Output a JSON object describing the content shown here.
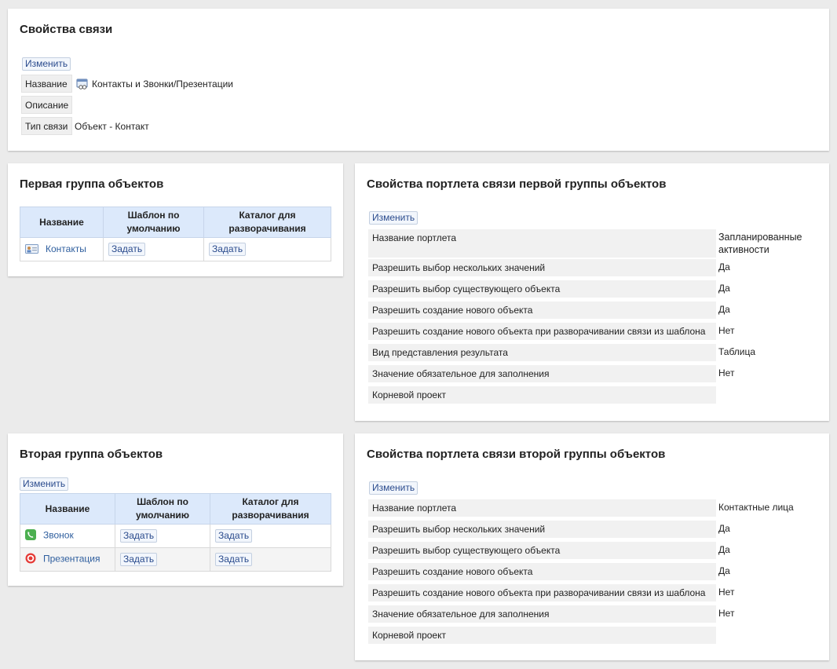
{
  "link_props": {
    "title": "Свойства связи",
    "edit_label": "Изменить",
    "rows": [
      {
        "label": "Название",
        "value": "Контакты и Звонки/Презентации"
      },
      {
        "label": "Описание",
        "value": ""
      },
      {
        "label": "Тип связи",
        "value": "Объект - Контакт"
      }
    ]
  },
  "group1": {
    "title": "Первая группа объектов",
    "columns": [
      "Название",
      "Шаблон по умолчанию",
      "Каталог для разворачивания"
    ],
    "rows": [
      {
        "name": "Контакты",
        "icon": "contact-card-icon",
        "template_btn": "Задать",
        "catalog_btn": "Задать"
      }
    ]
  },
  "group2": {
    "title": "Вторая группа объектов",
    "edit_label": "Изменить",
    "columns": [
      "Название",
      "Шаблон по умолчанию",
      "Каталог для разворачивания"
    ],
    "rows": [
      {
        "name": "Звонок",
        "icon": "phone-icon",
        "template_btn": "Задать",
        "catalog_btn": "Задать"
      },
      {
        "name": "Презентация",
        "icon": "target-icon",
        "template_btn": "Задать",
        "catalog_btn": "Задать"
      }
    ]
  },
  "portlet1": {
    "title": "Свойства портлета связи первой группы объектов",
    "edit_label": "Изменить",
    "rows": [
      {
        "label": "Название портлета",
        "value": "Запланированные активности"
      },
      {
        "label": "Разрешить выбор нескольких значений",
        "value": "Да"
      },
      {
        "label": "Разрешить выбор существующего объекта",
        "value": "Да"
      },
      {
        "label": "Разрешить создание нового объекта",
        "value": "Да"
      },
      {
        "label": "Разрешить создание нового объекта при разворачивании связи из шаблона",
        "value": "Нет"
      },
      {
        "label": "Вид представления результата",
        "value": "Таблица"
      },
      {
        "label": "Значение обязательное для заполнения",
        "value": "Нет"
      },
      {
        "label": "Корневой проект",
        "value": ""
      }
    ]
  },
  "portlet2": {
    "title": "Свойства портлета связи второй группы объектов",
    "edit_label": "Изменить",
    "rows": [
      {
        "label": "Название портлета",
        "value": "Контактные лица"
      },
      {
        "label": "Разрешить выбор нескольких значений",
        "value": "Да"
      },
      {
        "label": "Разрешить выбор существующего объекта",
        "value": "Да"
      },
      {
        "label": "Разрешить создание нового объекта",
        "value": "Да"
      },
      {
        "label": "Разрешить создание нового объекта при разворачивании связи из шаблона",
        "value": "Нет"
      },
      {
        "label": "Значение обязательное для заполнения",
        "value": "Нет"
      },
      {
        "label": "Корневой проект",
        "value": ""
      }
    ]
  }
}
